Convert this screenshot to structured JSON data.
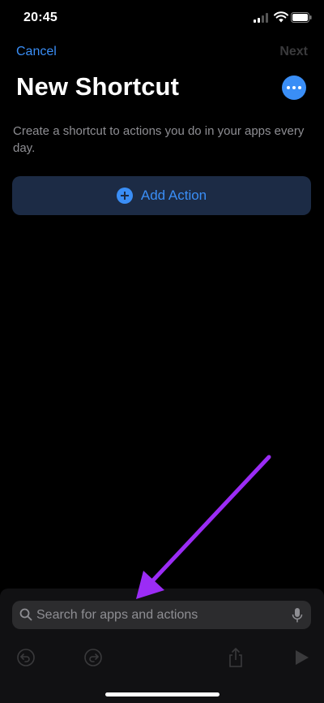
{
  "status": {
    "time": "20:45"
  },
  "nav": {
    "cancel": "Cancel",
    "next": "Next"
  },
  "header": {
    "title": "New Shortcut"
  },
  "description": "Create a shortcut to actions you do in your apps every day.",
  "add_action": {
    "label": "Add Action"
  },
  "search": {
    "placeholder": "Search for apps and actions",
    "value": ""
  },
  "colors": {
    "accent": "#3a8ef6",
    "annotation_arrow": "#9b2cf5"
  },
  "icons": [
    "signal-icon",
    "wifi-icon",
    "battery-icon",
    "more-icon",
    "plus-icon",
    "search-icon",
    "microphone-icon",
    "undo-icon",
    "redo-icon",
    "share-icon",
    "play-icon"
  ]
}
